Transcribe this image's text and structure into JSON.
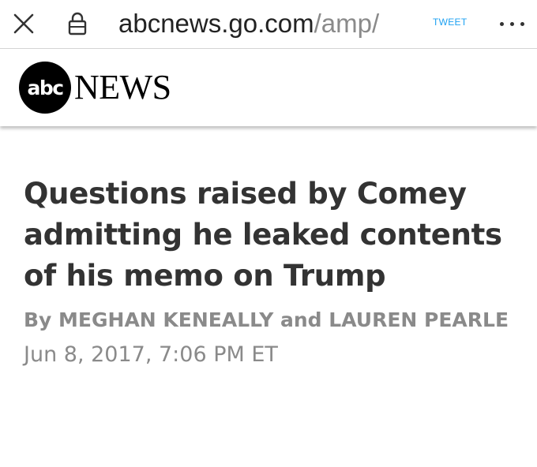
{
  "browser": {
    "url_host": "abcnews.go.com",
    "url_path": "/amp/",
    "tweet_label": "TWEET",
    "close_icon": "close-icon",
    "lock_icon": "lock-icon",
    "more_icon": "more-options-icon"
  },
  "site": {
    "logo_circle_text": "abc",
    "logo_wordmark": "NEWS"
  },
  "article": {
    "headline": "Questions raised by Comey admitting he leaked contents of his memo on Trump",
    "byline": "By MEGHAN KENEALLY and LAUREN PEARLE",
    "date": "Jun 8, 2017, 7:06 PM ET"
  },
  "colors": {
    "text_primary": "#333333",
    "text_secondary": "#8a8a8a",
    "tweet_accent": "#1da1f2",
    "logo": "#000000"
  }
}
